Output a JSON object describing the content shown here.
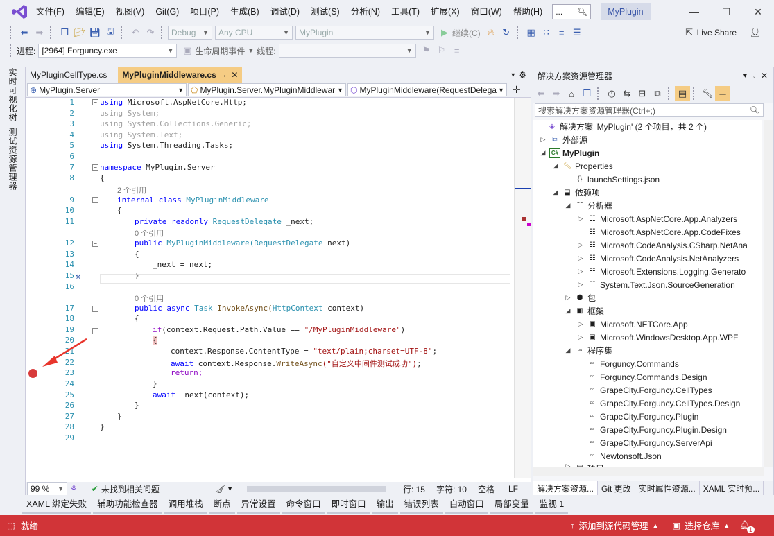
{
  "menu": {
    "items": [
      "文件(F)",
      "编辑(E)",
      "视图(V)",
      "Git(G)",
      "项目(P)",
      "生成(B)",
      "调试(D)",
      "测试(S)",
      "分析(N)",
      "工具(T)",
      "扩展(X)",
      "窗口(W)",
      "帮助(H)"
    ],
    "search_text": "...",
    "project_badge": "MyPlugin"
  },
  "toolbar1": {
    "config": "Debug",
    "platform": "Any CPU",
    "startup": "MyPlugin",
    "continue_label": "继续(C)",
    "live_share": "Live Share"
  },
  "toolbar2": {
    "process_label": "进程:",
    "process_value": "[2964] Forguncy.exe",
    "lifecycle_label": "生命周期事件",
    "thread_label": "线程:"
  },
  "left_strip": {
    "tab1": "实时可视化树",
    "tab2": "测试资源管理器"
  },
  "editor": {
    "tabs": [
      {
        "label": "MyPluginCellType.cs",
        "active": false
      },
      {
        "label": "MyPluginMiddleware.cs",
        "active": true
      }
    ],
    "nav": {
      "project": "MyPlugin.Server",
      "type": "MyPlugin.Server.MyPluginMiddlewar",
      "member": "MyPluginMiddleware(RequestDelega"
    },
    "refs": {
      "class_refs": "2 个引用",
      "field_refs": "0 个引用",
      "method_refs": "0 个引用"
    },
    "code": {
      "l1": "using Microsoft.AspNetCore.Http;",
      "l2": "using System;",
      "l3": "using System.Collections.Generic;",
      "l4": "using System.Text;",
      "l5": "using System.Threading.Tasks;",
      "l7_kw": "namespace",
      "l7_rest": " MyPlugin.Server",
      "l8": "{",
      "l9_kw": "internal class",
      "l9_name": " MyPluginMiddleware",
      "l10": "{",
      "l11_kw": "private readonly",
      "l11_type": " RequestDelegate",
      "l11_rest": " _next;",
      "l12_kw": "public",
      "l12_name": " MyPluginMiddleware(",
      "l12_type": "RequestDelegate",
      "l12_rest": " next)",
      "l13": "{",
      "l14": "_next = next;",
      "l15": "}",
      "l17_kw": "public async",
      "l17_type": " Task",
      "l17_name": " InvokeAsync(",
      "l17_ptype": "HttpContext",
      "l17_rest": " context)",
      "l18": "{",
      "l19_kw": "if",
      "l19_rest": "(context.Request.Path.Value == ",
      "l19_str": "\"/MyPluginMiddleware\"",
      "l19_end": ")",
      "l20": "{",
      "l21_rest": "context.Response.ContentType = ",
      "l21_str": "\"text/plain;charset=UTF-8\"",
      "l21_end": ";",
      "l22_kw": "await",
      "l22_rest": " context.Response.",
      "l22_mt": "WriteAsync",
      "l22_str": "(\"自定义中间件测试成功\")",
      "l22_end": ";",
      "l23": "return;",
      "l24": "}",
      "l25_kw": "await",
      "l25_rest": " _next(context);",
      "l26": "}",
      "l27": "}",
      "l28": "}"
    },
    "line_numbers": [
      "1",
      "2",
      "3",
      "4",
      "5",
      "6",
      "7",
      "8",
      "9",
      "10",
      "11",
      "12",
      "13",
      "14",
      "15",
      "16",
      "17",
      "18",
      "19",
      "20",
      "21",
      "22",
      "23",
      "24",
      "25",
      "26",
      "27",
      "28",
      "29"
    ],
    "status": {
      "zoom": "99 %",
      "issues": "未找到相关问题",
      "line": "行: 15",
      "col": "字符: 10",
      "ws": "空格",
      "eol": "LF"
    }
  },
  "solution_explorer": {
    "title": "解决方案资源管理器",
    "search_placeholder": "搜索解决方案资源管理器(Ctrl+;)",
    "tree": {
      "solution": "解决方案 'MyPlugin' (2 个项目，共 2 个)",
      "external": "外部源",
      "project": "MyPlugin",
      "properties": "Properties",
      "launch": "launchSettings.json",
      "deps": "依赖项",
      "analyzers": "分析器",
      "a1": "Microsoft.AspNetCore.App.Analyzers",
      "a2": "Microsoft.AspNetCore.App.CodeFixes",
      "a3": "Microsoft.CodeAnalysis.CSharp.NetAna",
      "a4": "Microsoft.CodeAnalysis.NetAnalyzers",
      "a5": "Microsoft.Extensions.Logging.Generato",
      "a6": "System.Text.Json.SourceGeneration",
      "packages": "包",
      "frameworks": "框架",
      "f1": "Microsoft.NETCore.App",
      "f2": "Microsoft.WindowsDesktop.App.WPF",
      "assemblies": "程序集",
      "s1": "Forguncy.Commands",
      "s2": "Forguncy.Commands.Design",
      "s3": "GrapeCity.Forguncy.CellTypes",
      "s4": "GrapeCity.Forguncy.CellTypes.Design",
      "s5": "GrapeCity.Forguncy.Plugin",
      "s6": "GrapeCity.Forguncy.Plugin.Design",
      "s7": "GrapeCity.Forguncy.ServerApi",
      "s8": "Newtonsoft.Json",
      "s9": "项目"
    },
    "bottom_tabs": [
      "解决方案资源...",
      "Git 更改",
      "实时属性资源...",
      "XAML 实时预..."
    ]
  },
  "tool_windows": [
    "XAML 绑定失败",
    "辅助功能检查器",
    "调用堆栈",
    "断点",
    "异常设置",
    "命令窗口",
    "即时窗口",
    "输出",
    "错误列表",
    "自动窗口",
    "局部变量",
    "监视 1"
  ],
  "status_bar": {
    "ready": "就绪",
    "source_control": "添加到源代码管理",
    "repo": "选择仓库",
    "notif_count": "1"
  }
}
